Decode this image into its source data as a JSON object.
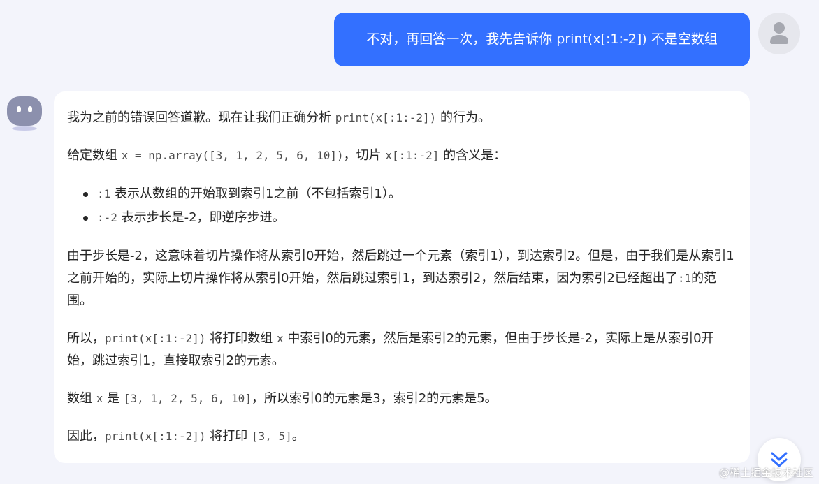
{
  "user_message": "不对，再回答一次，我先告诉你 print(x[:1:-2]) 不是空数组",
  "bot": {
    "p1": {
      "a": "我为之前的错误回答道歉。现在让我们正确分析 ",
      "code": "print(x[:1:-2])",
      "b": " 的行为。"
    },
    "p2": {
      "a": "给定数组 ",
      "code1": "x = np.array([3, 1, 2, 5, 6, 10])",
      "b": "，切片 ",
      "code2": "x[:1:-2]",
      "c": " 的含义是："
    },
    "bullets": [
      {
        "code": ":1",
        "text": " 表示从数组的开始取到索引1之前（不包括索引1）。"
      },
      {
        "code": ":-2",
        "text": " 表示步长是-2，即逆序步进。"
      }
    ],
    "p3": {
      "a": "由于步长是-2，这意味着切片操作将从索引0开始，然后跳过一个元素（索引1），到达索引2。但是，由于我们是从索引1之前开始的，实际上切片操作将从索引0开始，然后跳过索引1，到达索引2，然后结束，因为索引2已经超出了",
      "code": ":1",
      "b": "的范围。"
    },
    "p4": {
      "a": "所以，",
      "code1": "print(x[:1:-2])",
      "b": " 将打印数组 ",
      "code2": "x",
      "c": " 中索引0的元素，然后是索引2的元素，但由于步长是-2，实际上是从索引0开始，跳过索引1，直接取索引2的元素。"
    },
    "p5": {
      "a": "数组 ",
      "code1": "x",
      "b": " 是 ",
      "code2": "[3, 1, 2, 5, 6, 10]",
      "c": "，所以索引0的元素是3，索引2的元素是5。"
    },
    "p6": {
      "a": "因此，",
      "code1": "print(x[:1:-2])",
      "b": " 将打印 ",
      "code2": "[3, 5]",
      "c": "。"
    }
  },
  "watermark": "@稀土掘金技术社区",
  "icons": {
    "user_avatar": "user-silhouette-icon",
    "bot_avatar": "bot-face-icon",
    "scroll": "double-chevron-down-icon"
  },
  "colors": {
    "user_bubble": "#3370ff",
    "background": "#f3f4fb",
    "scroll_icon": "#3370ff"
  }
}
